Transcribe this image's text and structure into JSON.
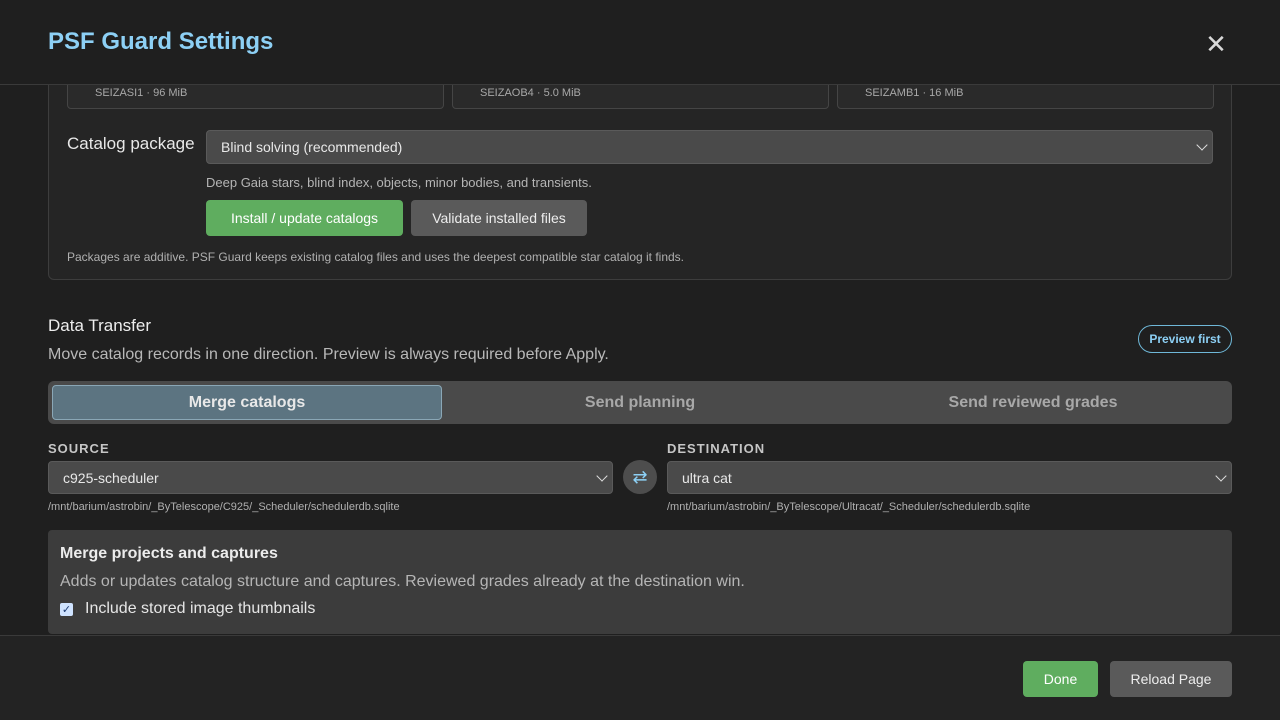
{
  "header": {
    "title": "PSF Guard Settings",
    "close_glyph": "✕"
  },
  "catalogs": {
    "cards": [
      {
        "meta": "SEIZASI1 · 96 MiB"
      },
      {
        "meta": "SEIZAOB4 · 5.0 MiB"
      },
      {
        "meta": "SEIZAMB1 · 16 MiB"
      }
    ],
    "package_label": "Catalog package",
    "package_selected": "Blind solving (recommended)",
    "package_description": "Deep Gaia stars, blind index, objects, minor bodies, and transients.",
    "install_label": "Install / update catalogs",
    "validate_label": "Validate installed files",
    "note": "Packages are additive. PSF Guard keeps existing catalog files and uses the deepest compatible star catalog it finds."
  },
  "data_transfer": {
    "title": "Data Transfer",
    "description": "Move catalog records in one direction. Preview is always required before Apply.",
    "badge": "Preview first",
    "tabs": [
      {
        "label": "Merge catalogs",
        "active": true
      },
      {
        "label": "Send planning",
        "active": false
      },
      {
        "label": "Send reviewed grades",
        "active": false
      }
    ],
    "source_label": "SOURCE",
    "source_selected": "c925-scheduler",
    "source_path": "/mnt/barium/astrobin/_ByTelescope/C925/_Scheduler/schedulerdb.sqlite",
    "destination_label": "DESTINATION",
    "destination_selected": "ultra cat",
    "destination_path": "/mnt/barium/astrobin/_ByTelescope/Ultracat/_Scheduler/schedulerdb.sqlite",
    "swap_glyph": "⇄"
  },
  "merge": {
    "title": "Merge projects and captures",
    "description": "Adds or updates catalog structure and captures. Reviewed grades already at the destination win.",
    "checkbox_label": "Include stored image thumbnails",
    "checkbox_checked": true,
    "check_glyph": "✓"
  },
  "footer": {
    "done_label": "Done",
    "reload_label": "Reload Page"
  },
  "colors": {
    "accent": "#8dd0f5",
    "primary_button": "#5fad5f",
    "secondary_button": "#5a5a5a",
    "background": "#1f1f1f",
    "active_tab": "#5c7481"
  }
}
